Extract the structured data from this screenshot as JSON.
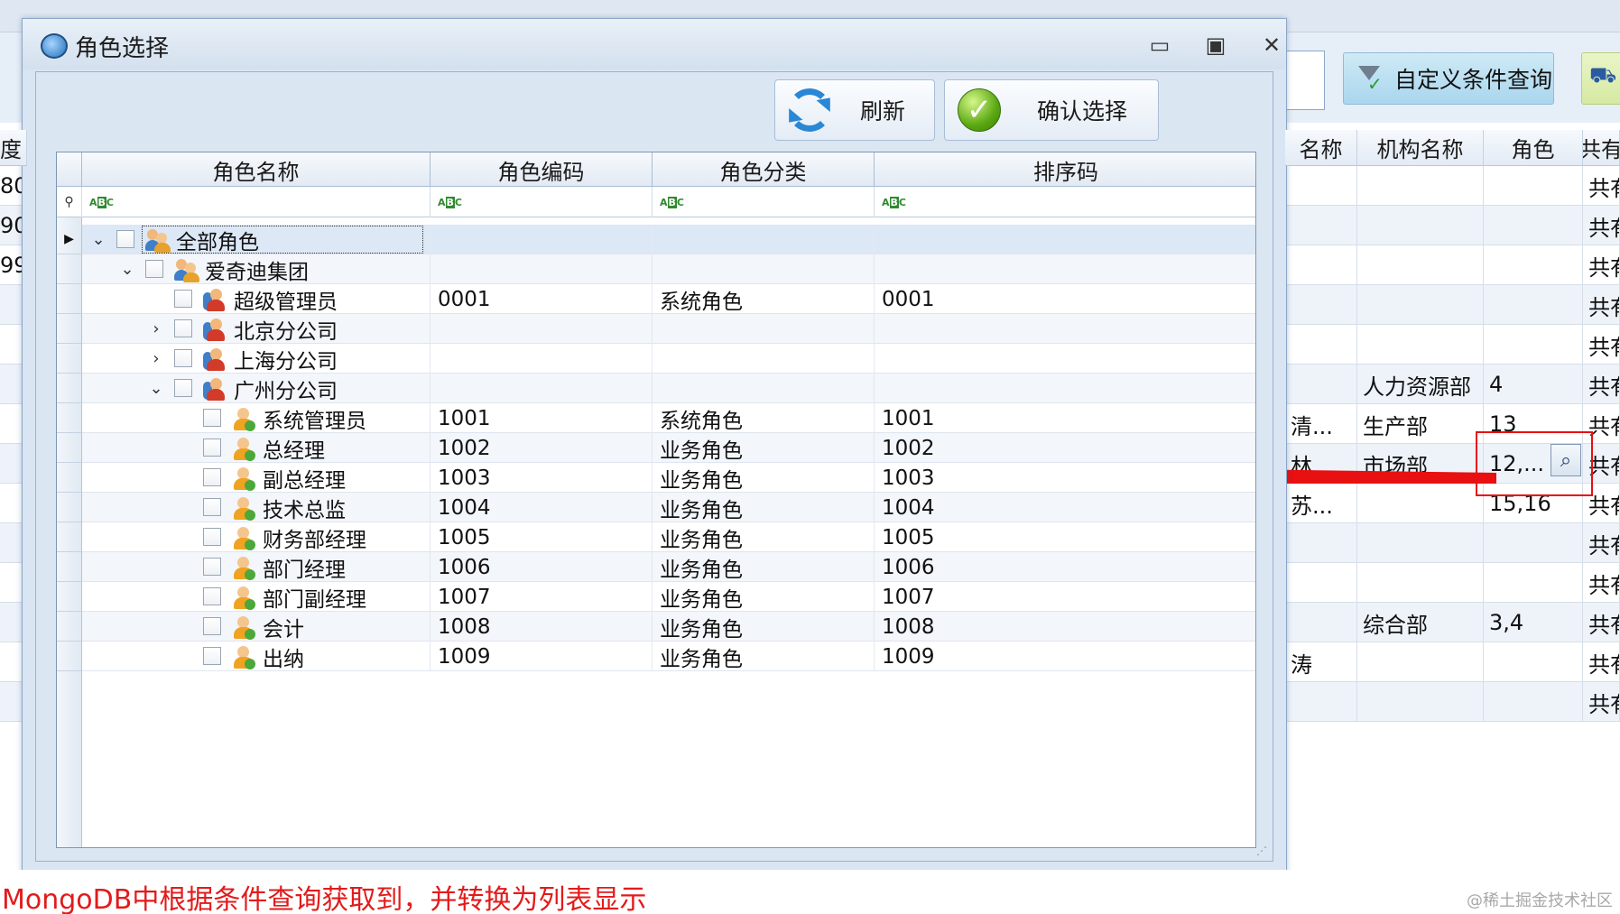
{
  "dialog": {
    "title": "角色选择",
    "window_buttons": {
      "minimize": "▭",
      "maximize": "▣",
      "close": "✕"
    },
    "toolbar": {
      "refresh_label": "刷新",
      "confirm_label": "确认选择"
    },
    "grid": {
      "columns": [
        "角色名称",
        "角色编码",
        "角色分类",
        "排序码"
      ],
      "filter_hint": "ABC",
      "rows": [
        {
          "name": "全部角色",
          "code": "",
          "category": "",
          "sort": "",
          "level": 0,
          "expander": "⌄",
          "icon": "group-icon",
          "selected": true
        },
        {
          "name": "爱奇迪集团",
          "code": "",
          "category": "",
          "sort": "",
          "level": 1,
          "expander": "⌄",
          "icon": "group-icon"
        },
        {
          "name": "超级管理员",
          "code": "0001",
          "category": "系统角色",
          "sort": "0001",
          "level": 2,
          "expander": "",
          "icon": "admin-user-icon"
        },
        {
          "name": "北京分公司",
          "code": "",
          "category": "",
          "sort": "",
          "level": 2,
          "expander": "›",
          "icon": "admin-user-icon"
        },
        {
          "name": "上海分公司",
          "code": "",
          "category": "",
          "sort": "",
          "level": 2,
          "expander": "›",
          "icon": "admin-user-icon"
        },
        {
          "name": "广州分公司",
          "code": "",
          "category": "",
          "sort": "",
          "level": 2,
          "expander": "⌄",
          "icon": "admin-user-icon"
        },
        {
          "name": "系统管理员",
          "code": "1001",
          "category": "系统角色",
          "sort": "1001",
          "level": 3,
          "expander": "",
          "icon": "role-user-icon"
        },
        {
          "name": "总经理",
          "code": "1002",
          "category": "业务角色",
          "sort": "1002",
          "level": 3,
          "expander": "",
          "icon": "role-user-icon"
        },
        {
          "name": "副总经理",
          "code": "1003",
          "category": "业务角色",
          "sort": "1003",
          "level": 3,
          "expander": "",
          "icon": "role-user-icon"
        },
        {
          "name": "技术总监",
          "code": "1004",
          "category": "业务角色",
          "sort": "1004",
          "level": 3,
          "expander": "",
          "icon": "role-user-icon"
        },
        {
          "name": "财务部经理",
          "code": "1005",
          "category": "业务角色",
          "sort": "1005",
          "level": 3,
          "expander": "",
          "icon": "role-user-icon"
        },
        {
          "name": "部门经理",
          "code": "1006",
          "category": "业务角色",
          "sort": "1006",
          "level": 3,
          "expander": "",
          "icon": "role-user-icon"
        },
        {
          "name": "部门副经理",
          "code": "1007",
          "category": "业务角色",
          "sort": "1007",
          "level": 3,
          "expander": "",
          "icon": "role-user-icon"
        },
        {
          "name": "会计",
          "code": "1008",
          "category": "业务角色",
          "sort": "1008",
          "level": 3,
          "expander": "",
          "icon": "role-user-icon"
        },
        {
          "name": "出纳",
          "code": "1009",
          "category": "业务角色",
          "sort": "1009",
          "level": 3,
          "expander": "",
          "icon": "role-user-icon"
        }
      ]
    }
  },
  "background": {
    "custom_query_label": "自定义条件查询",
    "binoculars_icon": "binoculars-icon",
    "columns": [
      "名称",
      "机构名称",
      "角色",
      "共有"
    ],
    "left_edge_values": [
      "80",
      "90",
      "99"
    ],
    "left_header": "度",
    "rows": [
      {
        "name": "",
        "org": "",
        "role": "",
        "share": "共有"
      },
      {
        "name": "",
        "org": "",
        "role": "",
        "share": "共有"
      },
      {
        "name": "",
        "org": "",
        "role": "",
        "share": "共有"
      },
      {
        "name": "",
        "org": "",
        "role": "",
        "share": "共有"
      },
      {
        "name": "",
        "org": "",
        "role": "",
        "share": "共有"
      },
      {
        "name": "",
        "org": "人力资源部",
        "role": "4",
        "share": "共有"
      },
      {
        "name": "清...",
        "org": "生产部",
        "role": "13",
        "share": "共有"
      },
      {
        "name": "林...",
        "org": "市场部",
        "role": "12,...",
        "share": "共有"
      },
      {
        "name": "苏...",
        "org": "",
        "role": "15,16",
        "share": "共有"
      },
      {
        "name": "",
        "org": "",
        "role": "",
        "share": "共有"
      },
      {
        "name": "",
        "org": "",
        "role": "",
        "share": "共有"
      },
      {
        "name": "",
        "org": "综合部",
        "role": "3,4",
        "share": "共有"
      },
      {
        "name": "涛",
        "org": "",
        "role": "",
        "share": "共有"
      },
      {
        "name": "",
        "org": "",
        "role": "",
        "share": "共有"
      }
    ]
  },
  "caption": "MongoDB中根据条件查询获取到，并转换为列表显示",
  "watermark": "@稀土掘金技术社区",
  "colors": {
    "arrow": "#e81010",
    "caption": "#e21b1b",
    "accent": "#2a87d6"
  }
}
